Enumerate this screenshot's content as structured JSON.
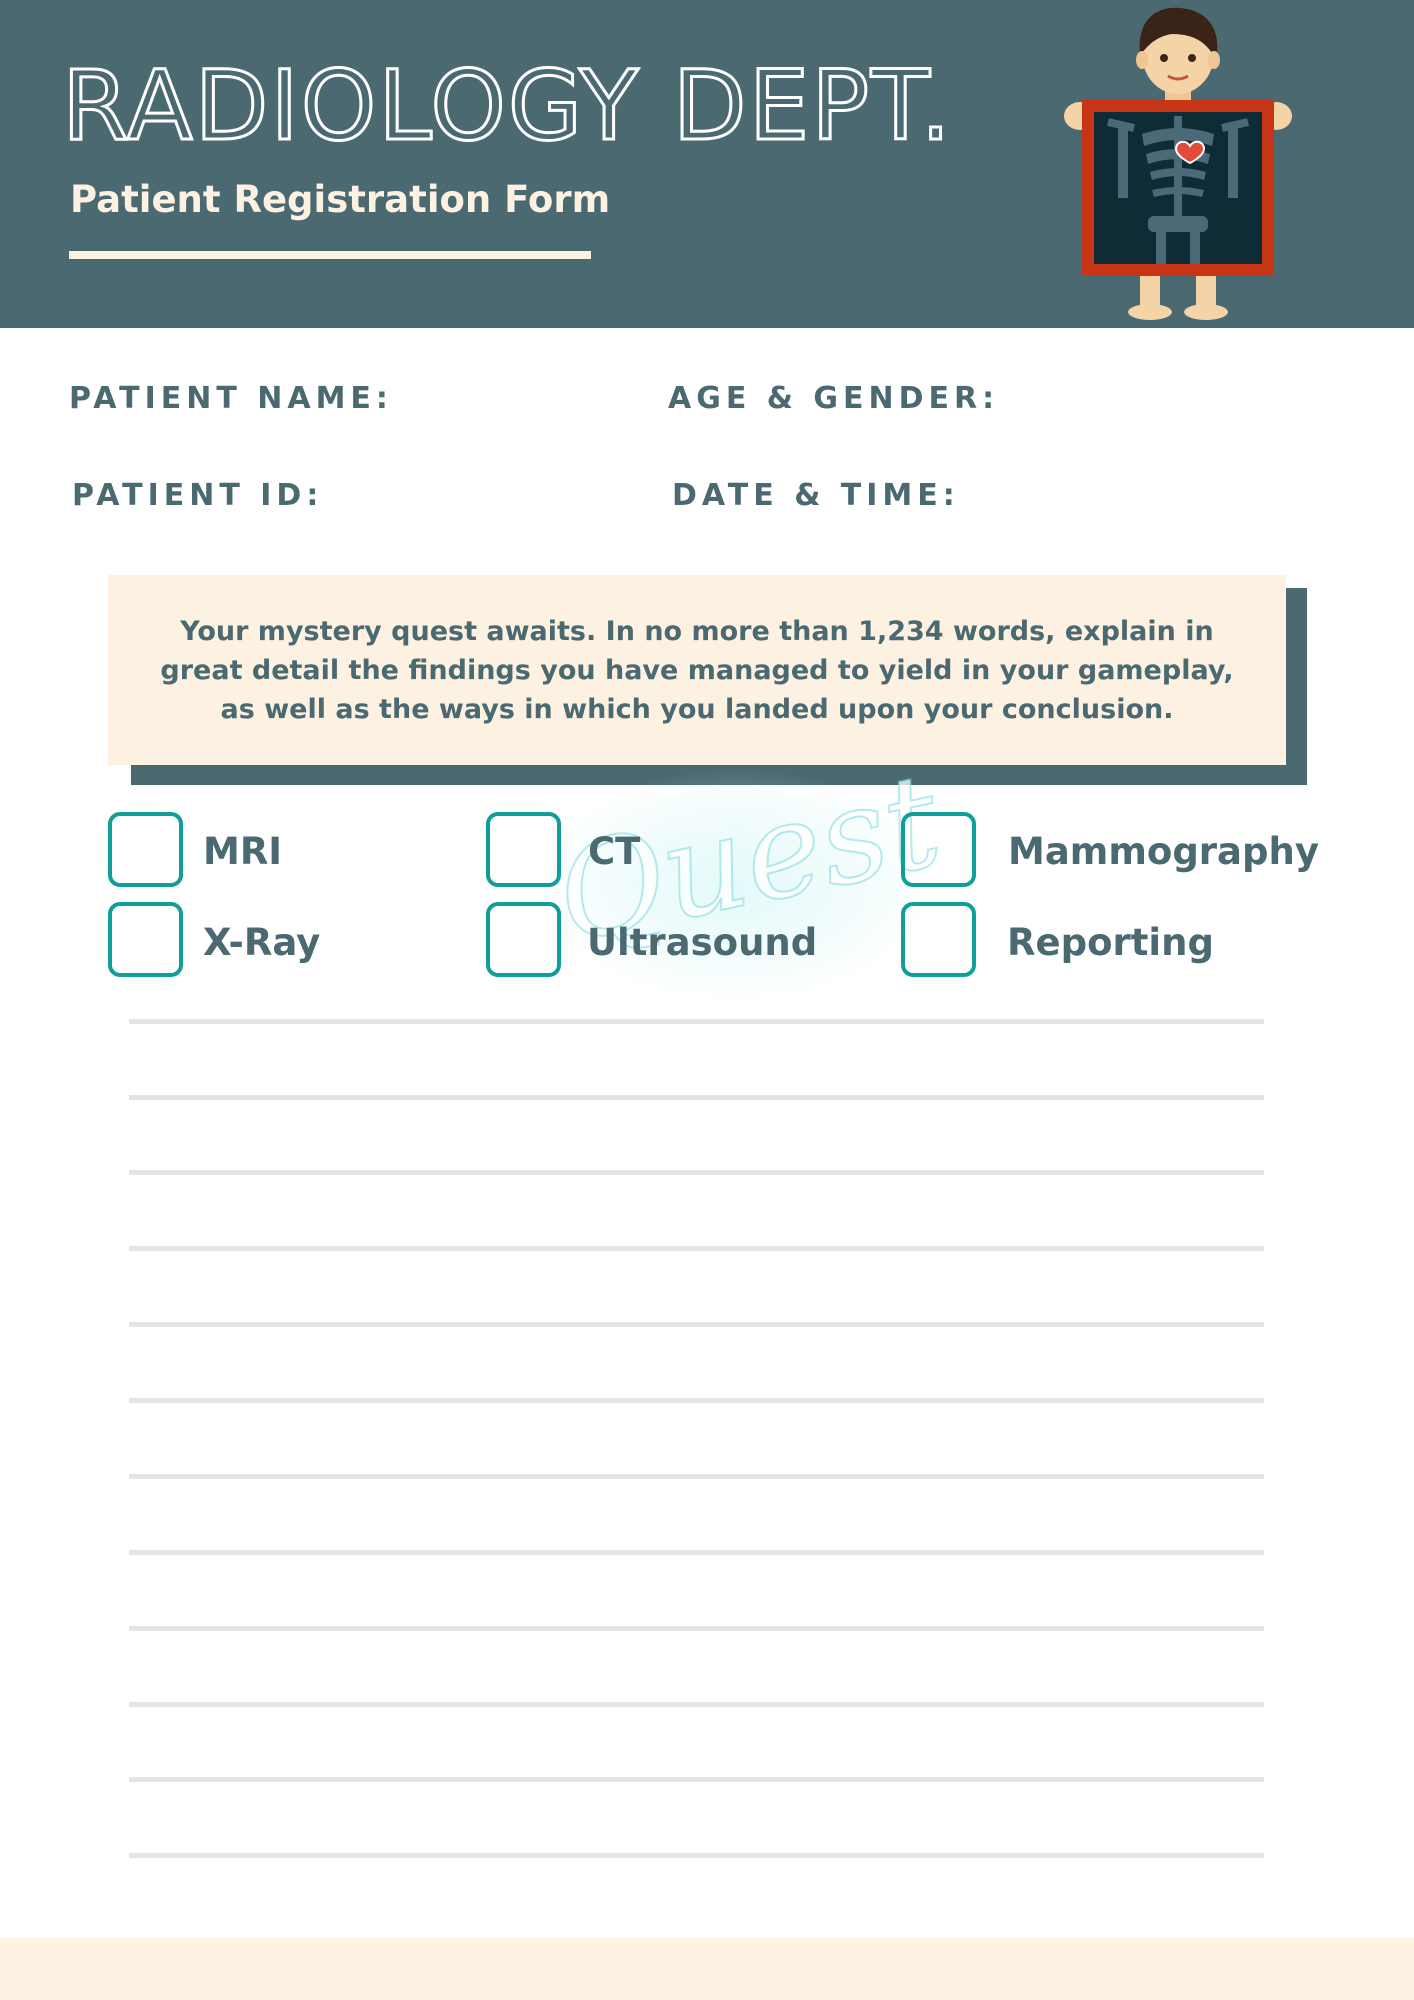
{
  "header": {
    "title": "RADIOLOGY DEPT.",
    "subtitle": "Patient Registration Form",
    "illustration_icon": "xray-patient-icon"
  },
  "fields": {
    "patient_name": "PATIENT NAME:",
    "age_gender": "AGE & GENDER:",
    "patient_id": "PATIENT ID:",
    "date_time": "DATE & TIME:"
  },
  "note": {
    "text": "Your mystery quest awaits. In no more than 1,234 words, explain in great detail the findings you have managed to yield in your gameplay, as well as the ways in which you landed upon your conclusion."
  },
  "watermark": {
    "text": "Quest"
  },
  "options": [
    {
      "label": "MRI",
      "checked": false
    },
    {
      "label": "CT",
      "checked": false
    },
    {
      "label": "Mammography",
      "checked": false
    },
    {
      "label": "X-Ray",
      "checked": false
    },
    {
      "label": "Ultrasound",
      "checked": false
    },
    {
      "label": "Reporting",
      "checked": false
    }
  ],
  "colors": {
    "header_bg": "#4b6971",
    "cream": "#fdf1e2",
    "checkbox_border": "#0f9e99",
    "text": "#4b6971",
    "rule": "#e4e4e4"
  }
}
